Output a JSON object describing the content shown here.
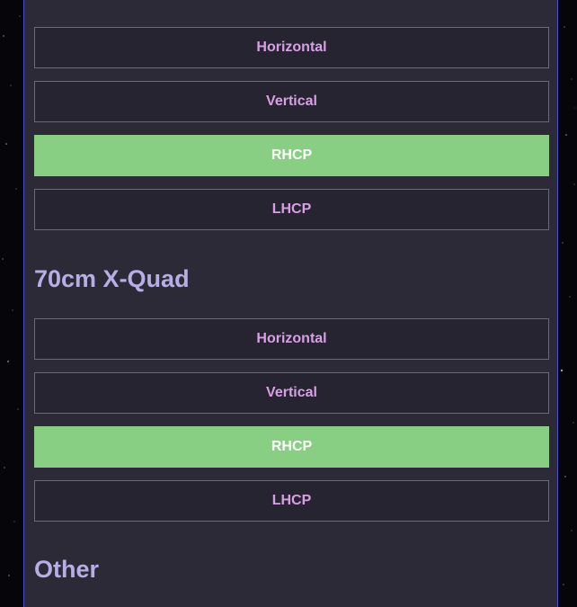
{
  "sections": [
    {
      "title": "",
      "options": [
        {
          "label": "Horizontal",
          "active": false
        },
        {
          "label": "Vertical",
          "active": false
        },
        {
          "label": "RHCP",
          "active": true
        },
        {
          "label": "LHCP",
          "active": false
        }
      ]
    },
    {
      "title": "70cm X-Quad",
      "options": [
        {
          "label": "Horizontal",
          "active": false
        },
        {
          "label": "Vertical",
          "active": false
        },
        {
          "label": "RHCP",
          "active": true
        },
        {
          "label": "LHCP",
          "active": false
        }
      ]
    },
    {
      "title": "Other",
      "options": []
    }
  ],
  "colors": {
    "panel_bg": "#2b2a36",
    "button_bg": "#252430",
    "button_text": "#d8a0e4",
    "active_bg": "#88cf84",
    "active_text": "#ffffff",
    "heading": "#b7aee6",
    "panel_border": "#4a4fd0"
  }
}
